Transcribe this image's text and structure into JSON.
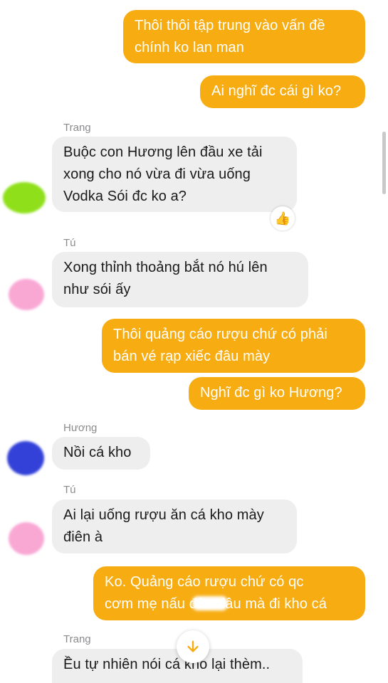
{
  "colors": {
    "outgoing_bubble": "#f7ad12",
    "incoming_bubble": "#eeeeef",
    "accent": "#f7ad12",
    "avatar_trang": "#8fe01a",
    "avatar_tu": "#f9a8d4",
    "avatar_huong": "#3341d8"
  },
  "messages": [
    {
      "direction": "outgoing",
      "text": "Thôi thôi tập trung vào vấn đề\nchính ko lan man"
    },
    {
      "direction": "outgoing",
      "text": "Ai nghĩ đc cái gì ko?"
    },
    {
      "direction": "incoming",
      "sender": "Trang",
      "text": "Buộc con Hương lên đầu xe tải\nxong cho nó vừa đi vừa uống\nVodka Sói đc ko a?",
      "reaction": "thumbs-up-icon"
    },
    {
      "direction": "incoming",
      "sender": "Tú",
      "text": "Xong thỉnh thoảng bắt nó hú lên\nnhư sói ấy"
    },
    {
      "direction": "outgoing",
      "text": "Thôi quảng cáo rượu chứ có phải\nbán vé rạp xiếc đâu mày"
    },
    {
      "direction": "outgoing",
      "text": "Nghĩ đc gì ko Hương?"
    },
    {
      "direction": "incoming",
      "sender": "Hương",
      "text": "Nồi cá kho"
    },
    {
      "direction": "incoming",
      "sender": "Tú",
      "text": "Ai lại uống rượu ăn cá kho mày\nđiên à"
    },
    {
      "direction": "outgoing",
      "text": "Ko. Quảng cáo rượu chứ có qc\ncơm mẹ nấu đâu đâu mà đi kho cá"
    },
    {
      "direction": "incoming",
      "sender": "Trang",
      "text": "Ều tự nhiên nói cá kho lại thèm.."
    }
  ],
  "jump_to_latest": {
    "icon": "arrow-down-icon"
  }
}
